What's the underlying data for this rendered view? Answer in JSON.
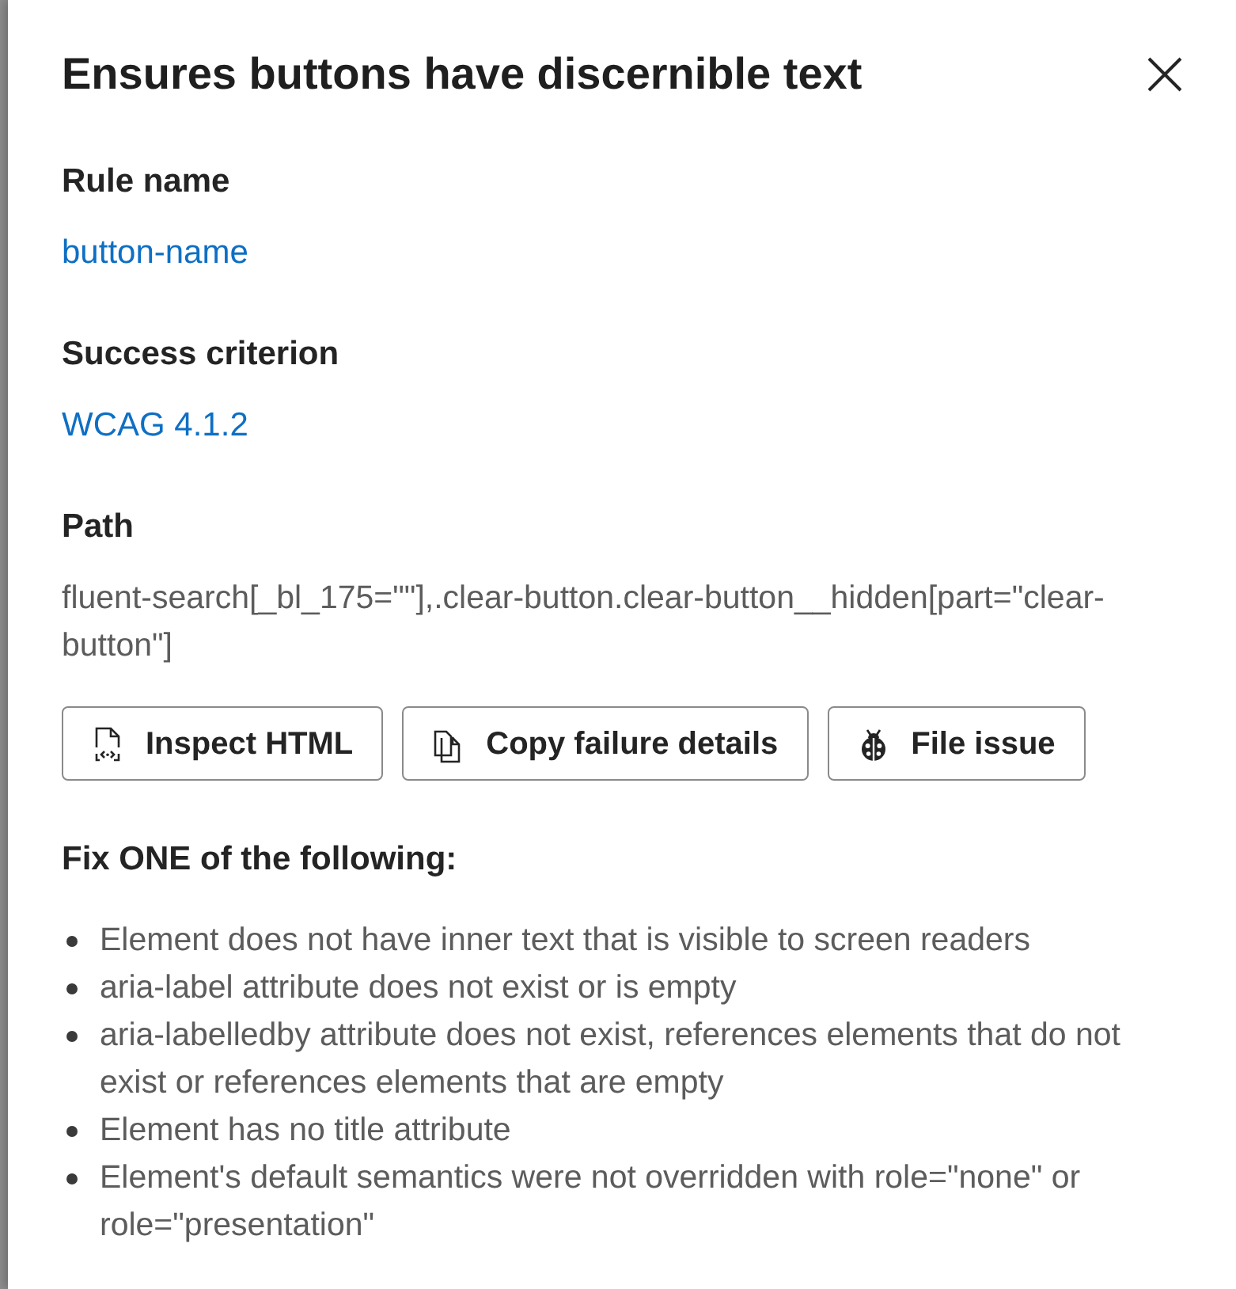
{
  "dialog": {
    "title": "Ensures buttons have discernible text"
  },
  "sections": [
    {
      "heading": "Rule name",
      "kind": "link",
      "value": "button-name"
    },
    {
      "heading": "Success criterion",
      "kind": "link",
      "value": "WCAG 4.1.2"
    },
    {
      "heading": "Path",
      "kind": "text",
      "value": "fluent-search[_bl_175=\"\"],.clear-button.clear-button__hidden[part=\"clear-button\"]"
    }
  ],
  "buttons": [
    {
      "label": "Inspect HTML"
    },
    {
      "label": "Copy failure details"
    },
    {
      "label": "File issue"
    }
  ],
  "fix": {
    "heading": "Fix ONE of the following:",
    "items": [
      "Element does not have inner text that is visible to screen readers",
      "aria-label attribute does not exist or is empty",
      "aria-labelledby attribute does not exist, references elements that do not exist or references elements that are empty",
      "Element has no title attribute",
      "Element's default semantics were not overridden with role=\"none\" or role=\"presentation\""
    ]
  }
}
